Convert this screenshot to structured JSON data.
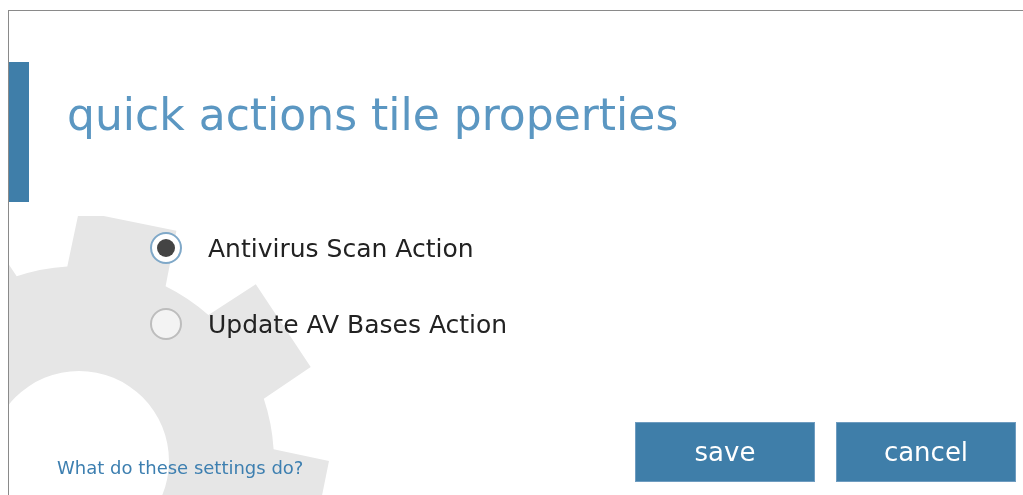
{
  "title": "quick actions tile properties",
  "options": [
    {
      "label": "Antivirus Scan Action",
      "selected": true
    },
    {
      "label": "Update AV Bases Action",
      "selected": false
    }
  ],
  "help_link": "What do these settings do?",
  "buttons": [
    "save",
    "cancel"
  ]
}
